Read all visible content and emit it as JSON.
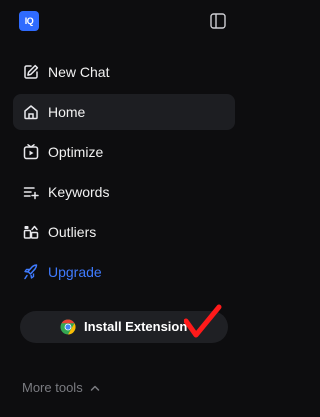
{
  "header": {
    "logo_text": "IQ",
    "logo_color": "#2f6bff",
    "panel_icon": "sidebar-toggle-icon"
  },
  "nav": {
    "items": [
      {
        "label": "New Chat",
        "icon": "edit-icon"
      },
      {
        "label": "Home",
        "icon": "home-icon",
        "active": true
      },
      {
        "label": "Optimize",
        "icon": "optimize-icon"
      },
      {
        "label": "Keywords",
        "icon": "keywords-icon"
      },
      {
        "label": "Outliers",
        "icon": "outliers-icon"
      },
      {
        "label": "Upgrade",
        "icon": "rocket-icon",
        "color": "#3f7bff"
      }
    ]
  },
  "install": {
    "label": "Install Extension",
    "icon": "chrome-icon"
  },
  "annotation": {
    "icon": "red-checkmark",
    "color": "#ff1a1a"
  },
  "footer": {
    "more_tools_label": "More tools",
    "icon": "chevron-up-icon"
  }
}
